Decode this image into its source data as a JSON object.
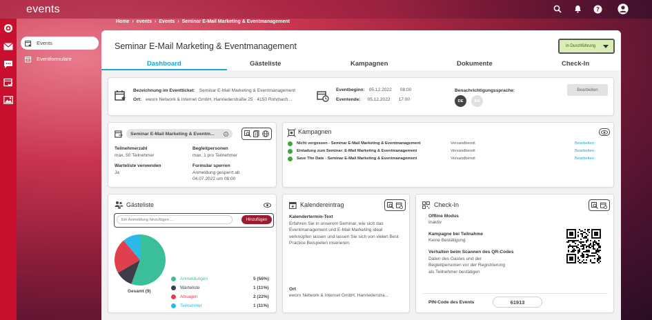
{
  "app": {
    "brand": "events"
  },
  "breadcrumb": [
    "Home",
    "events",
    "Events",
    "Seminar E-Mail Marketing & Eventmanagement"
  ],
  "subnav": [
    {
      "label": "Events",
      "active": true
    },
    {
      "label": "Eventformulare",
      "active": false
    }
  ],
  "page": {
    "title": "Seminar E-Mail Marketing & Eventmanagement",
    "status": "In Durchführung",
    "tabs": [
      "Dashboard",
      "Gästeliste",
      "Kampagnen",
      "Dokumente",
      "Check-In"
    ],
    "active_tab": "Dashboard"
  },
  "info": {
    "ticket_label": "Bezeichnung im Eventticket:",
    "ticket_value": "Seminar E-Mail Marketing & Eventmanagement",
    "ort_label": "Ort:",
    "ort_value": "eworx Network & Internet GmbH, Hanriederstraße 25 · 4150 Rohrbach...",
    "begin_label": "Eventbeginn:",
    "begin_date": "05.12.2022",
    "begin_time": "08:00",
    "end_label": "Eventende:",
    "end_date": "05.12.2022",
    "end_time": "17:00",
    "lang_label": "Benachrichtigungssprache:",
    "lang_de": "DE",
    "lang_en": "EN",
    "edit_label": "Bearbeiten"
  },
  "event_card": {
    "chip": "Seminar E-Mail Marketing & Eventm...",
    "teilnehmer_label": "Teilnehmerzahl",
    "teilnehmer_value": "max. 50 Teilnehmer",
    "begleit_label": "Begleitpersonen",
    "begleit_value": "max. 1 pro Teilnehmer",
    "warte_label": "Warteliste verwenden",
    "warte_value": "Ja",
    "sperren_label": "Formular sperren",
    "sperren_value_1": "Anmeldung gesperrt ab",
    "sperren_value_2": "04.07.2022 um 08:00"
  },
  "kampagnen": {
    "title": "Kampagnen",
    "items": [
      {
        "name": "Nicht vergessen - Seminar E-Mail Marketing & Eventmanagement",
        "status": "Versandbereit",
        "action": "Bearbeiten"
      },
      {
        "name": "Einladung zum Seminar: E-Mail Marketing & Eventmanagement",
        "status": "Versandbereit",
        "action": "Bearbeiten"
      },
      {
        "name": "Save The Date - Seminar E-Mail Marketing & Eventmanagement",
        "status": "Versandbereit",
        "action": "Bearbeiten"
      }
    ]
  },
  "gaesteliste": {
    "title": "Gästeliste",
    "placeholder": "Ein Anmeldung hinzufügen ...",
    "add_label": "Hinzufügen",
    "total_label": "Gesamt (9)",
    "legend": [
      {
        "label": "Anmeldungen",
        "value": "5 (56%)",
        "color": "#3bbf9a"
      },
      {
        "label": "Warteliste",
        "value": "1 (11%)",
        "color": "#3d3d4a"
      },
      {
        "label": "Absagen",
        "value": "2 (22%)",
        "color": "#e0404d"
      },
      {
        "label": "Teilnehmer",
        "value": "1 (11%)",
        "color": "#2bb9e8"
      }
    ]
  },
  "chart_data": {
    "type": "pie",
    "categories": [
      "Anmeldungen",
      "Warteliste",
      "Absagen",
      "Teilnehmer"
    ],
    "values": [
      5,
      1,
      2,
      1
    ]
  },
  "kalender": {
    "title": "Kalendereintrag",
    "text_label": "Kalendertermin-Text",
    "text_value": "Erfahren Sie in unserem Seminar, wie sich das Eventmanagement und E-Mail Marketing ideal verknüpfen lassen und lassen Sie sich von vielen Best Practice Beispielen inserieren.",
    "ort_label": "Ort",
    "ort_value": "eworx Network & Internet GmbH, Hanriederstra..."
  },
  "checkin": {
    "title": "Check-In",
    "offline_label": "Offline Modus",
    "offline_value": "Inaktiv",
    "kampagne_label": "Kampagne bei Teilnahme",
    "kampagne_value": "Keine Bestätigung",
    "scan_label": "Verhalten beim Scannen des QR-Codes",
    "scan_value": "Daten des Gastes und der Begleitpersonen vor der Registrierung als Teilnehmer bestätigen",
    "pin_label": "PIN-Code des Events",
    "pin_value": "61913"
  },
  "colors": {
    "accent": "#1aa3d9",
    "brand_red": "#c8102e",
    "status_bg": "#d9edb5",
    "add_button": "#9b1b30"
  }
}
